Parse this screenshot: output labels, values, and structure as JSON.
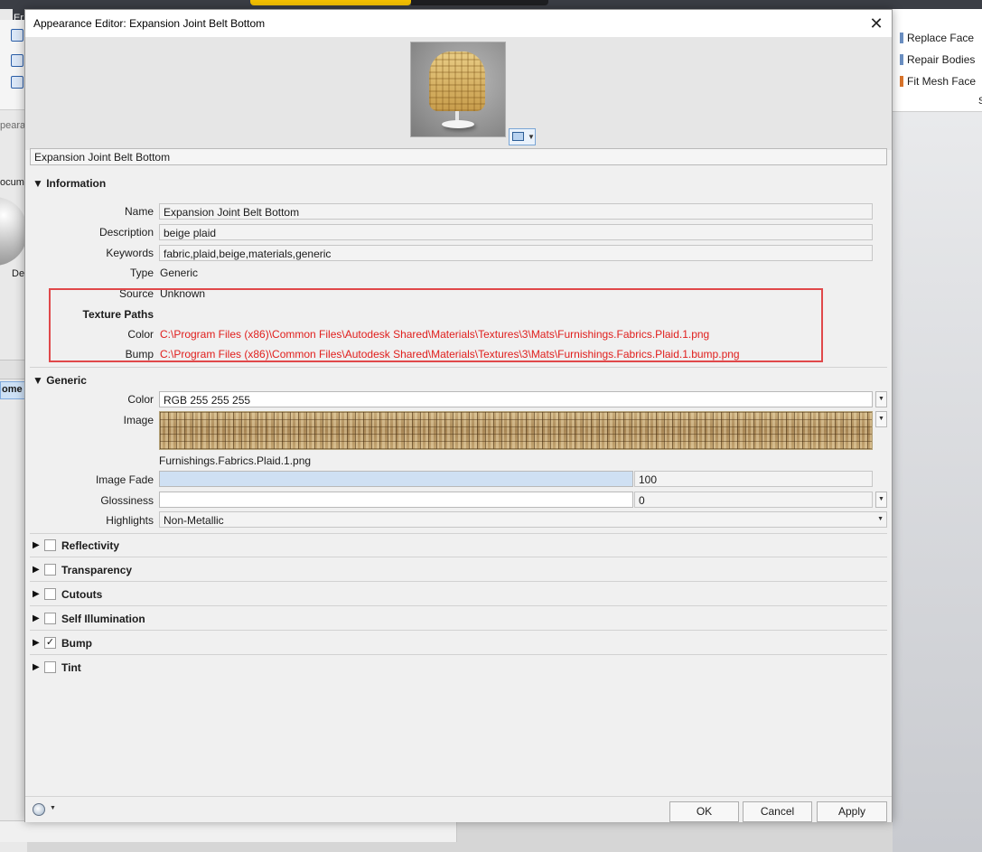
{
  "background": {
    "left_tab_text": "Er",
    "left_labels": [
      "peara",
      "ocum",
      "De",
      "ome"
    ],
    "ribbon_items": [
      "Replace Face",
      "Repair Bodies",
      "Fit Mesh Face"
    ],
    "ribbon_edge_letter": "S"
  },
  "dialog": {
    "title": "Appearance Editor: Expansion Joint Belt Bottom",
    "close_glyph": "✕",
    "appearance_name": "Expansion Joint Belt Bottom"
  },
  "information": {
    "header": "Information",
    "name_label": "Name",
    "name_value": "Expansion Joint Belt Bottom",
    "description_label": "Description",
    "description_value": "beige plaid",
    "keywords_label": "Keywords",
    "keywords_value": "fabric,plaid,beige,materials,generic",
    "type_label": "Type",
    "type_value": "Generic",
    "source_label": "Source",
    "source_value": "Unknown",
    "texture_paths_label": "Texture Paths",
    "color_label": "Color",
    "color_path": "C:\\Program Files (x86)\\Common Files\\Autodesk Shared\\Materials\\Textures\\3\\Mats\\Furnishings.Fabrics.Plaid.1.png",
    "bump_label": "Bump",
    "bump_path": "C:\\Program Files (x86)\\Common Files\\Autodesk Shared\\Materials\\Textures\\3\\Mats\\Furnishings.Fabrics.Plaid.1.bump.png",
    "highlight_color": "#e0484a"
  },
  "generic": {
    "header": "Generic",
    "color_label": "Color",
    "color_value": "RGB 255 255 255",
    "image_label": "Image",
    "image_filename": "Furnishings.Fabrics.Plaid.1.png",
    "image_fade_label": "Image Fade",
    "image_fade_value": "100",
    "glossiness_label": "Glossiness",
    "glossiness_value": "0",
    "highlights_label": "Highlights",
    "highlights_value": "Non-Metallic"
  },
  "sections": [
    {
      "label": "Reflectivity",
      "checked": false
    },
    {
      "label": "Transparency",
      "checked": false
    },
    {
      "label": "Cutouts",
      "checked": false
    },
    {
      "label": "Self Illumination",
      "checked": false
    },
    {
      "label": "Bump",
      "checked": true
    },
    {
      "label": "Tint",
      "checked": false
    }
  ],
  "footer": {
    "ok_label": "OK",
    "cancel_label": "Cancel",
    "apply_label": "Apply"
  },
  "colors": {
    "path_text": "#e0201e",
    "slider_fill": "#cfe0f3",
    "accent_blue": "#7aa6d6"
  }
}
